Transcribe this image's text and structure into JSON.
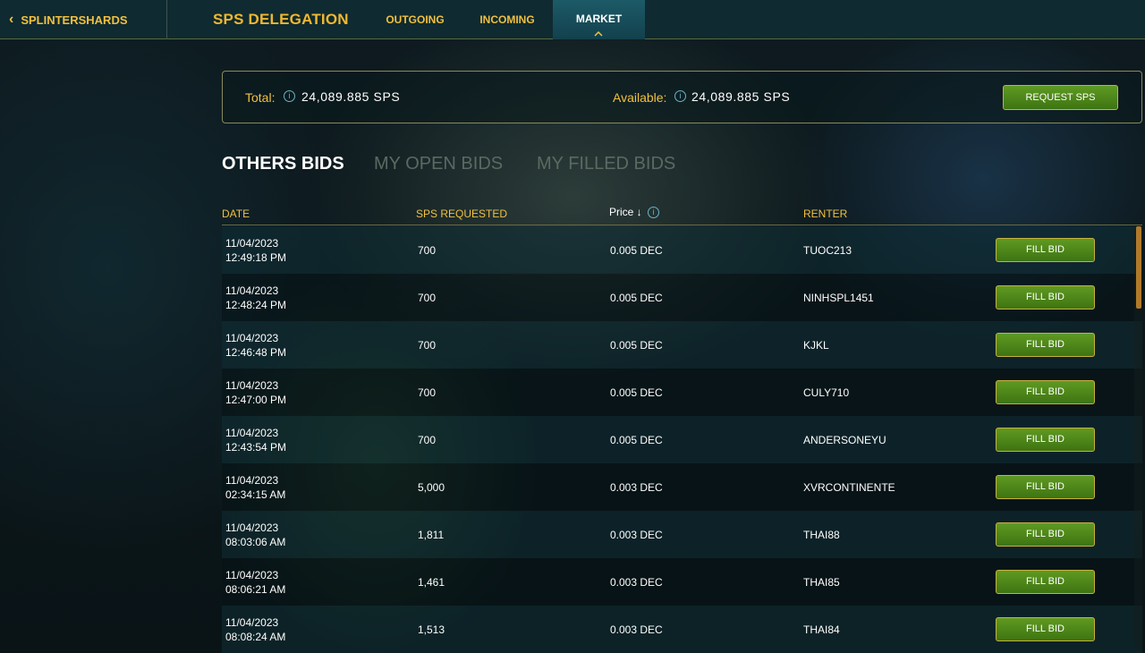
{
  "nav": {
    "back_label": "SPLINTERSHARDS",
    "brand": "SPS DELEGATION",
    "tabs": {
      "outgoing": "OUTGOING",
      "incoming": "INCOMING",
      "market": "MARKET"
    }
  },
  "summary": {
    "total_label": "Total:",
    "total_value": "24,089.885 SPS",
    "available_label": "Available:",
    "available_value": "24,089.885 SPS",
    "request_button": "REQUEST SPS"
  },
  "bid_tabs": {
    "others": "OTHERS BIDS",
    "my_open": "MY OPEN BIDS",
    "my_filled": "MY FILLED BIDS"
  },
  "table": {
    "headers": {
      "date": "DATE",
      "sps": "SPS REQUESTED",
      "price": "Price ↓",
      "renter": "RENTER"
    },
    "fill_label": "FILL BID",
    "rows": [
      {
        "date": "11/04/2023",
        "time": "12:49:18 PM",
        "sps": "700",
        "price": "0.005 DEC",
        "renter": "TUOC213"
      },
      {
        "date": "11/04/2023",
        "time": "12:48:24 PM",
        "sps": "700",
        "price": "0.005 DEC",
        "renter": "NINHSPL1451"
      },
      {
        "date": "11/04/2023",
        "time": "12:46:48 PM",
        "sps": "700",
        "price": "0.005 DEC",
        "renter": "KJKL"
      },
      {
        "date": "11/04/2023",
        "time": "12:47:00 PM",
        "sps": "700",
        "price": "0.005 DEC",
        "renter": "CULY710"
      },
      {
        "date": "11/04/2023",
        "time": "12:43:54 PM",
        "sps": "700",
        "price": "0.005 DEC",
        "renter": "ANDERSONEYU"
      },
      {
        "date": "11/04/2023",
        "time": "02:34:15 AM",
        "sps": "5,000",
        "price": "0.003 DEC",
        "renter": "XVRCONTINENTE"
      },
      {
        "date": "11/04/2023",
        "time": "08:03:06 AM",
        "sps": "1,811",
        "price": "0.003 DEC",
        "renter": "THAI88"
      },
      {
        "date": "11/04/2023",
        "time": "08:06:21 AM",
        "sps": "1,461",
        "price": "0.003 DEC",
        "renter": "THAI85"
      },
      {
        "date": "11/04/2023",
        "time": "08:08:24 AM",
        "sps": "1,513",
        "price": "0.003 DEC",
        "renter": "THAI84"
      }
    ]
  },
  "icons": {
    "back": "chevron-left-icon",
    "info": "info-icon",
    "caret": "caret-up-icon"
  },
  "colors": {
    "accent_gold": "#f0c040",
    "button_green": "#4e8a1a",
    "active_tab": "#1d5a68"
  }
}
